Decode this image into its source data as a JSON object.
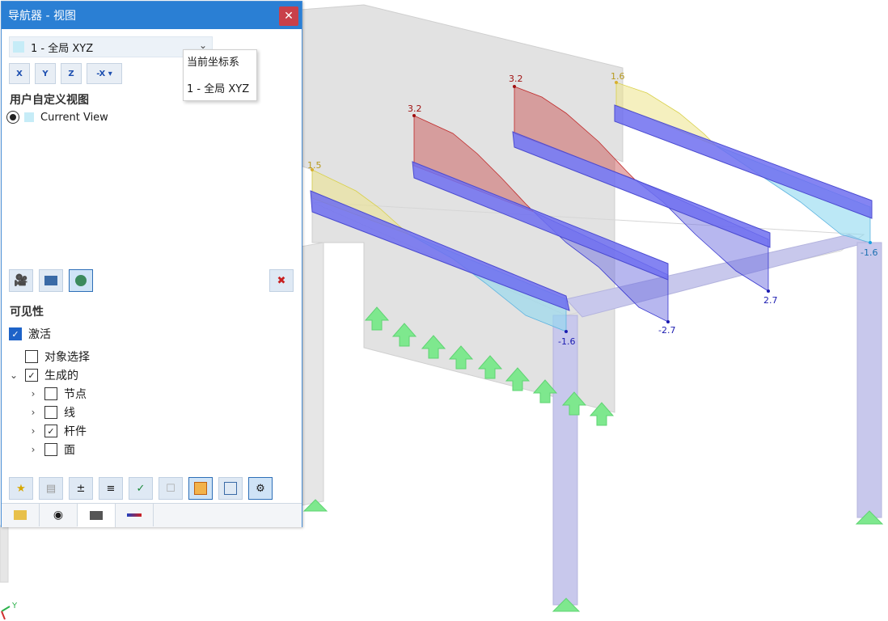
{
  "navigator": {
    "title": "导航器 - 视图",
    "coordinate_system_selected": "1 - 全局 XYZ",
    "axis_buttons": [
      "X",
      "Y",
      "Z",
      "-X"
    ],
    "user_views_heading": "用户自定义视图",
    "views": [
      {
        "label": "Current View",
        "selected": true
      }
    ],
    "visibility_heading": "可见性",
    "activate_label": "激活",
    "tree": {
      "object_selection": "对象选择",
      "generated": "生成的",
      "nodes": "节点",
      "lines": "线",
      "members": "杆件",
      "surfaces": "面"
    }
  },
  "dropdown": {
    "header": "当前坐标系",
    "option": "1 - 全局 XYZ"
  },
  "diagram_labels": {
    "beam1_max": "1.5",
    "beam1_min": "-1.6",
    "beam2_max": "3.2",
    "beam2_min": "-2.7",
    "beam3_max": "3.2",
    "beam3_min": "2.7",
    "beam4_max": "1.6",
    "beam4_min": "-1.6"
  },
  "axis_indicator": "Y",
  "colors": {
    "title_bar": "#2a7fd4",
    "beam": "#6f6ff0",
    "column": "#c8c8ec",
    "support": "#7ee88e",
    "diagram_pos": "#c84a4a",
    "diagram_yellow": "#e8e070",
    "diagram_neg": "#4040d0"
  }
}
